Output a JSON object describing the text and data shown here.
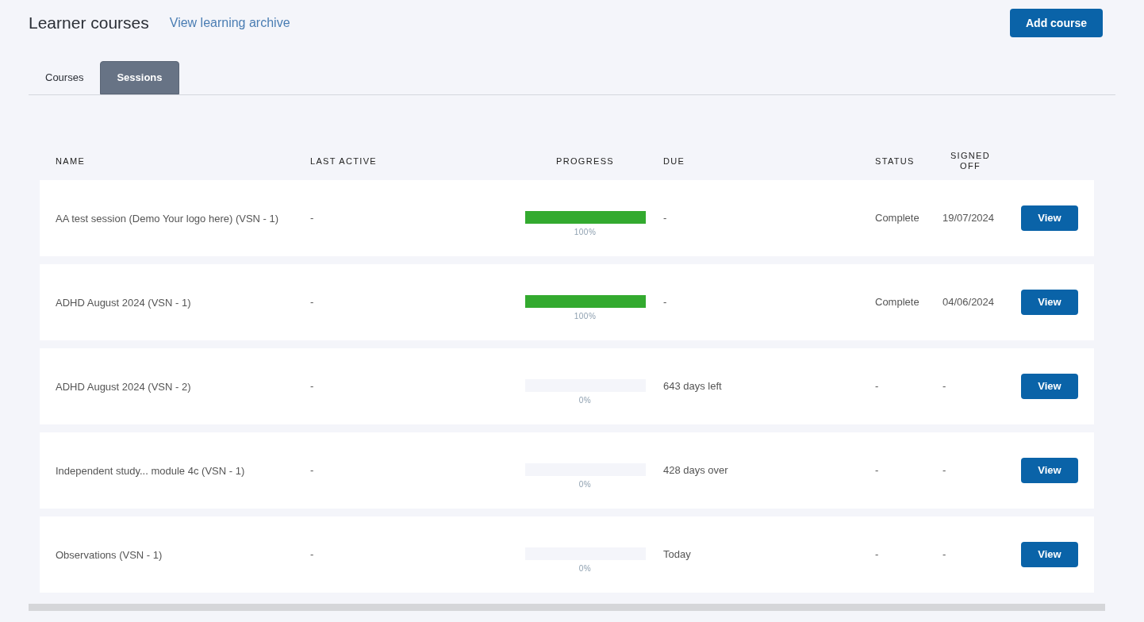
{
  "header": {
    "title": "Learner courses",
    "archive_link": "View learning archive",
    "add_button": "Add course"
  },
  "tabs": [
    {
      "label": "Courses",
      "selected": false
    },
    {
      "label": "Sessions",
      "selected": true
    }
  ],
  "table": {
    "columns": [
      "NAME",
      "LAST ACTIVE",
      "PROGRESS",
      "DUE",
      "STATUS",
      "SIGNED OFF"
    ],
    "rows": [
      {
        "name": "AA test session (Demo Your logo here) (VSN - 1)",
        "last_active": "-",
        "progress": {
          "level": 1,
          "label": "100%"
        },
        "due": "-",
        "status": "Complete",
        "signed_off": "19/07/2024",
        "action": "View"
      },
      {
        "name": "ADHD August 2024 (VSN - 1)",
        "last_active": "-",
        "progress": {
          "level": 1,
          "label": "100%"
        },
        "due": "-",
        "status": "Complete",
        "signed_off": "04/06/2024",
        "action": "View"
      },
      {
        "name": "ADHD August 2024 (VSN - 2)",
        "last_active": "-",
        "progress": {
          "level": 0,
          "label": "0%"
        },
        "due": "643 days left",
        "status": "-",
        "signed_off": "-",
        "action": "View"
      },
      {
        "name": "Independent study... module 4c (VSN - 1)",
        "last_active": "-",
        "progress": {
          "level": 0,
          "label": "0%"
        },
        "due": "428 days over",
        "status": "-",
        "signed_off": "-",
        "action": "View"
      },
      {
        "name": "Observations (VSN - 1)",
        "last_active": "-",
        "progress": {
          "level": 0,
          "label": "0%"
        },
        "due": "Today",
        "status": "-",
        "signed_off": "-",
        "action": "View"
      }
    ]
  }
}
